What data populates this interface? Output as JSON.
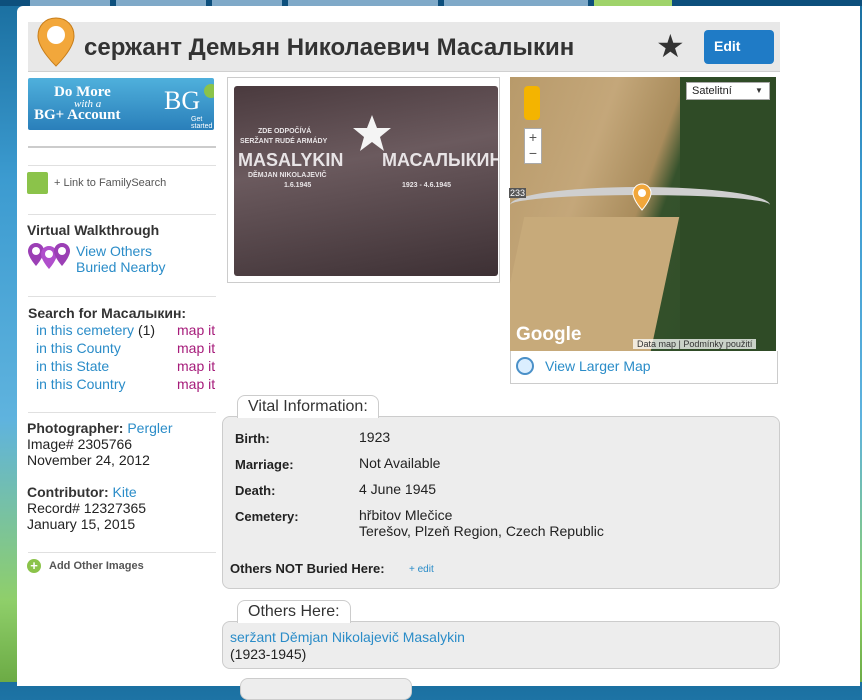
{
  "header": {
    "title": "сержант Демьян Николаевич Масалыкин",
    "edit_label": "Edit"
  },
  "promo": {
    "line1": "Do More",
    "line2": "with a",
    "line3": "BG+ Account",
    "brand": "BG",
    "cta": "Get started"
  },
  "sidebar": {
    "familysearch_link": "+ Link to FamilySearch",
    "virtual_walkthrough": {
      "heading": "Virtual Walkthrough",
      "link_line1": "View Others",
      "link_line2": "Buried Nearby"
    },
    "search": {
      "heading": "Search for Масалыкин:",
      "rows": [
        {
          "label": "in this cemetery",
          "count": "(1)",
          "map": "map it"
        },
        {
          "label": "in this County",
          "count": "",
          "map": "map it"
        },
        {
          "label": "in this State",
          "count": "",
          "map": "map it"
        },
        {
          "label": "in this Country",
          "count": "",
          "map": "map it"
        }
      ]
    },
    "photographer": {
      "label": "Photographer:",
      "name": "Pergler",
      "image_no": "Image# 2305766",
      "date": "November 24, 2012"
    },
    "contributor": {
      "label": "Contributor:",
      "name": "Kite",
      "record_no": "Record# 12327365",
      "date": "January 15, 2015"
    },
    "add_images": "Add Other Images"
  },
  "photo": {
    "inscription_lines": [
      "ZDE ODPOČÍVÁ",
      "SERŽANT RUDÉ ARMÁDY",
      "MASALYKIN",
      "МАСАЛЫКИН",
      "DĚMJAN NIKOLAJEVIČ",
      "1.6.1945",
      "1923 - 4.6.1945"
    ]
  },
  "map": {
    "type_select": "Satelitní",
    "zoom_in": "+",
    "zoom_out": "−",
    "road_number": "233",
    "logo": "Google",
    "map_data": "Data map",
    "terms": "Podmínky použití",
    "larger_link": "View Larger Map"
  },
  "vital": {
    "tab_label": "Vital Information:",
    "birth_label": "Birth:",
    "birth_value": "1923",
    "marriage_label": "Marriage:",
    "marriage_value": "Not Available",
    "death_label": "Death:",
    "death_value": "4 June 1945",
    "cemetery_label": "Cemetery:",
    "cemetery_name": "hřbitov Mlečice",
    "cemetery_location": "Terešov, Plzeň Region, Czech Republic",
    "others_not_buried": "Others NOT Buried Here:",
    "edit_link": "+ edit"
  },
  "others_here": {
    "tab_label": "Others Here:",
    "person_name": "seržant Děmjan Nikolajevič Masalykin",
    "person_dates": "(1923-1945)"
  },
  "colors": {
    "link": "#2a8cc8",
    "map_link": "#a61b7a",
    "edit_button": "#1f7bc6"
  }
}
